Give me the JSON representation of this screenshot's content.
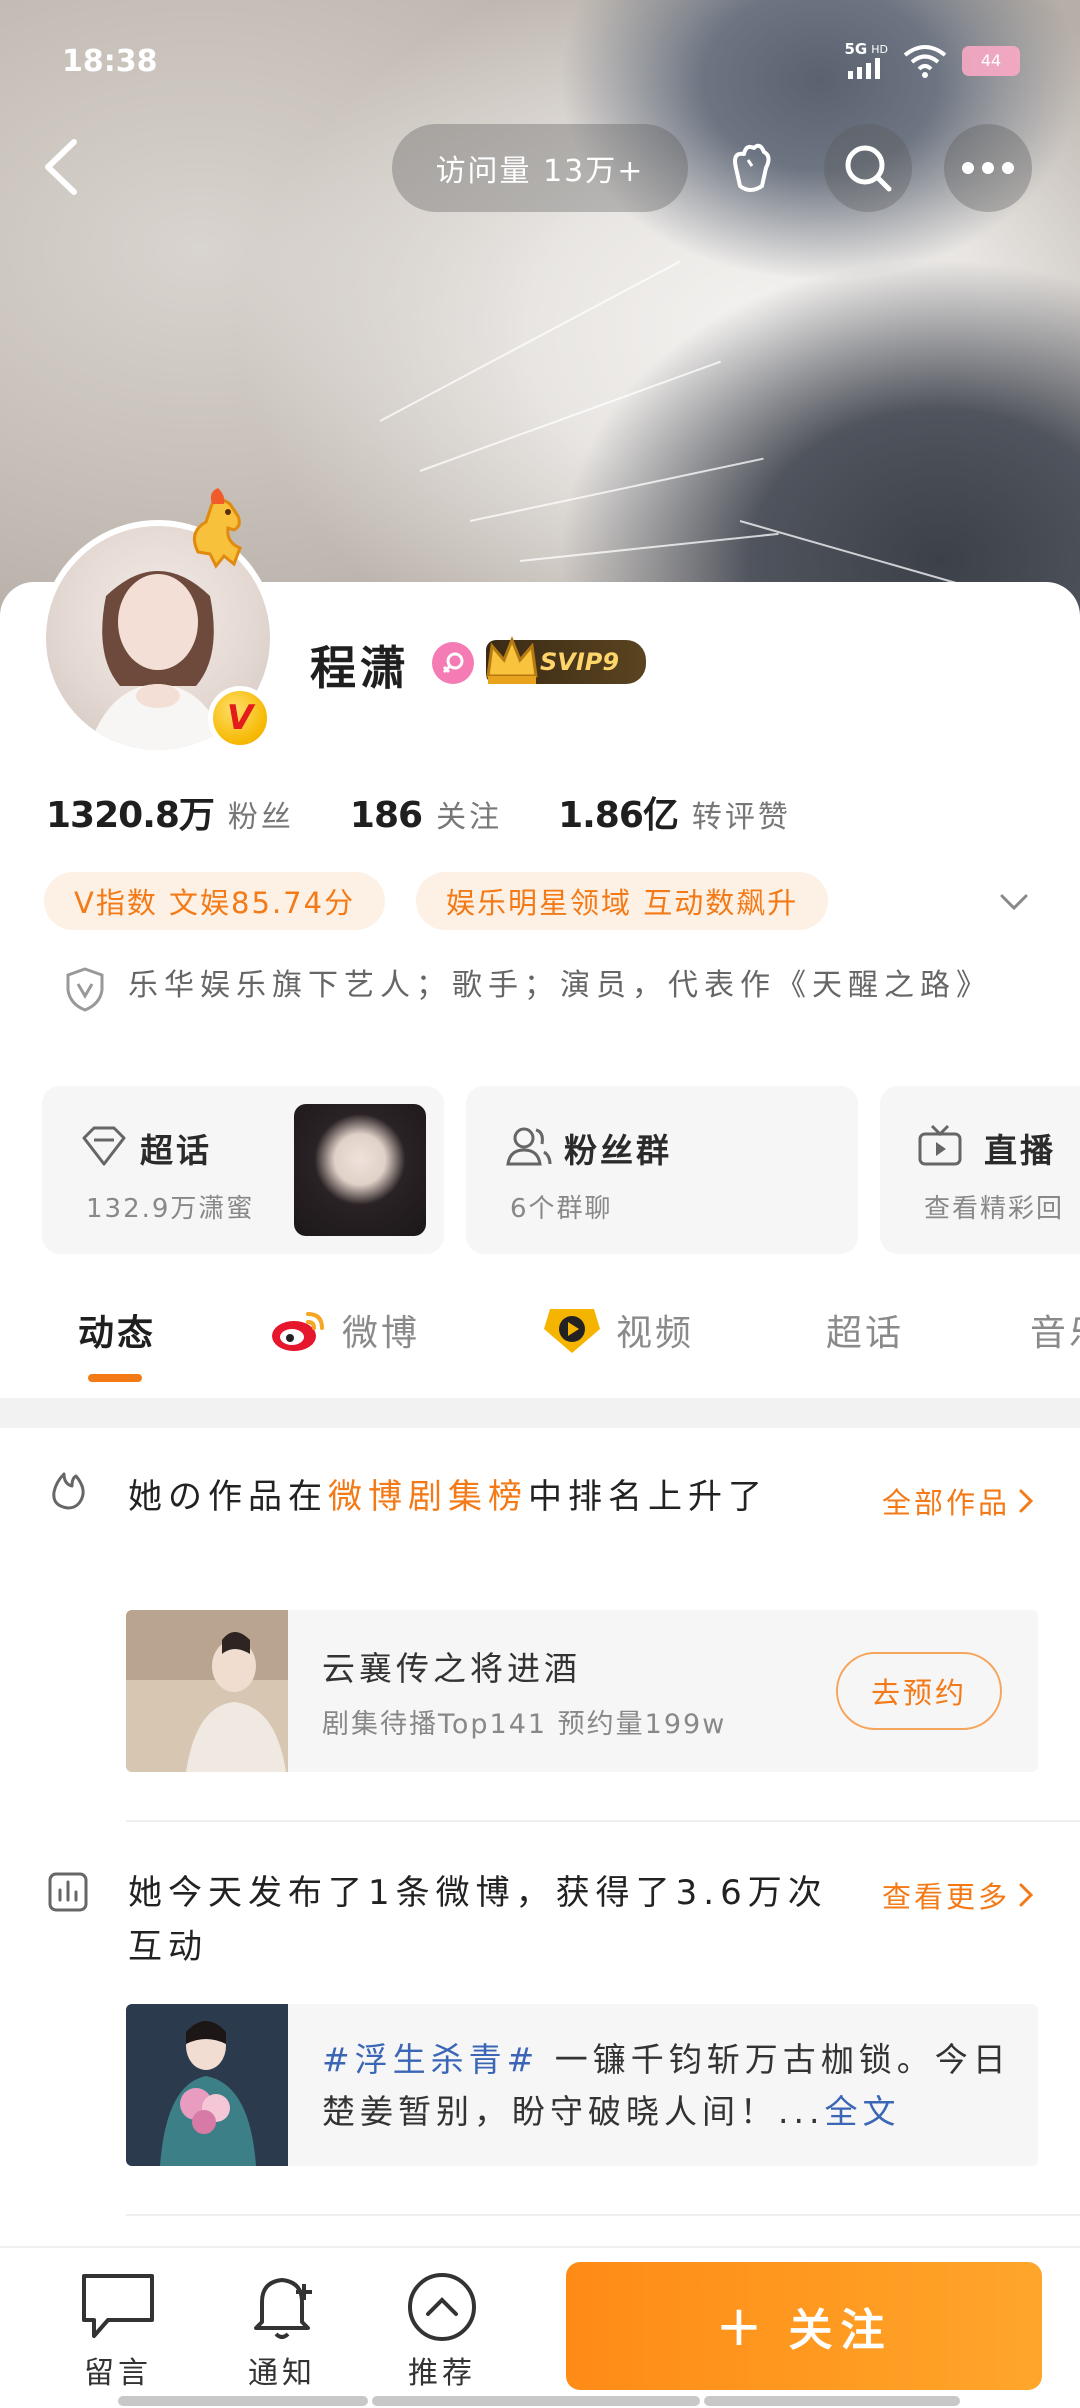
{
  "status_bar": {
    "time": "18:38",
    "network": "5G",
    "hd": "HD",
    "battery": "44"
  },
  "top_bar": {
    "visits": "访问量 13万+"
  },
  "profile": {
    "name": "程潇",
    "svip": "SVIP9",
    "stats": [
      {
        "value": "1320.8万",
        "label": "粉丝"
      },
      {
        "value": "186",
        "label": "关注"
      },
      {
        "value": "1.86亿",
        "label": "转评赞"
      }
    ],
    "tags": [
      "V指数 文娱85.74分",
      "娱乐明星领域 互动数飙升"
    ],
    "bio": "乐华娱乐旗下艺人；歌手；演员，代表作《天醒之路》"
  },
  "feature_cards": [
    {
      "title": "超话",
      "sub": "132.9万潇蜜",
      "icon": "diamond-icon"
    },
    {
      "title": "粉丝群",
      "sub": "6个群聊",
      "icon": "group-icon"
    },
    {
      "title": "直播",
      "sub": "查看精彩回",
      "icon": "tv-icon"
    }
  ],
  "tabs": [
    "动态",
    "微博",
    "视频",
    "超话",
    "音乐"
  ],
  "feed": {
    "item1": {
      "title_pre": "她の作品在",
      "title_hl": "微博剧集榜",
      "title_post": "中排名上升了",
      "more": "全部作品",
      "media_title": "云襄传之将进酒",
      "media_sub": "剧集待播Top141 预约量199w",
      "button": "去预约"
    },
    "item2": {
      "title": "她今天发布了1条微博，获得了3.6万次互动",
      "more": "查看更多",
      "topic": "#浮生杀青#",
      "text": " 一镰千钧斩万古枷锁。今日楚姜暂别，盼守破晓人间！...",
      "full": "全文"
    }
  },
  "bottom_bar": {
    "comment": "留言",
    "notify": "通知",
    "recommend": "推荐",
    "follow": "关注",
    "follow_plus": "+"
  },
  "colors": {
    "accent": "#f37a16",
    "topic": "#3a66b5",
    "follow_bg": "#ff8b16"
  }
}
